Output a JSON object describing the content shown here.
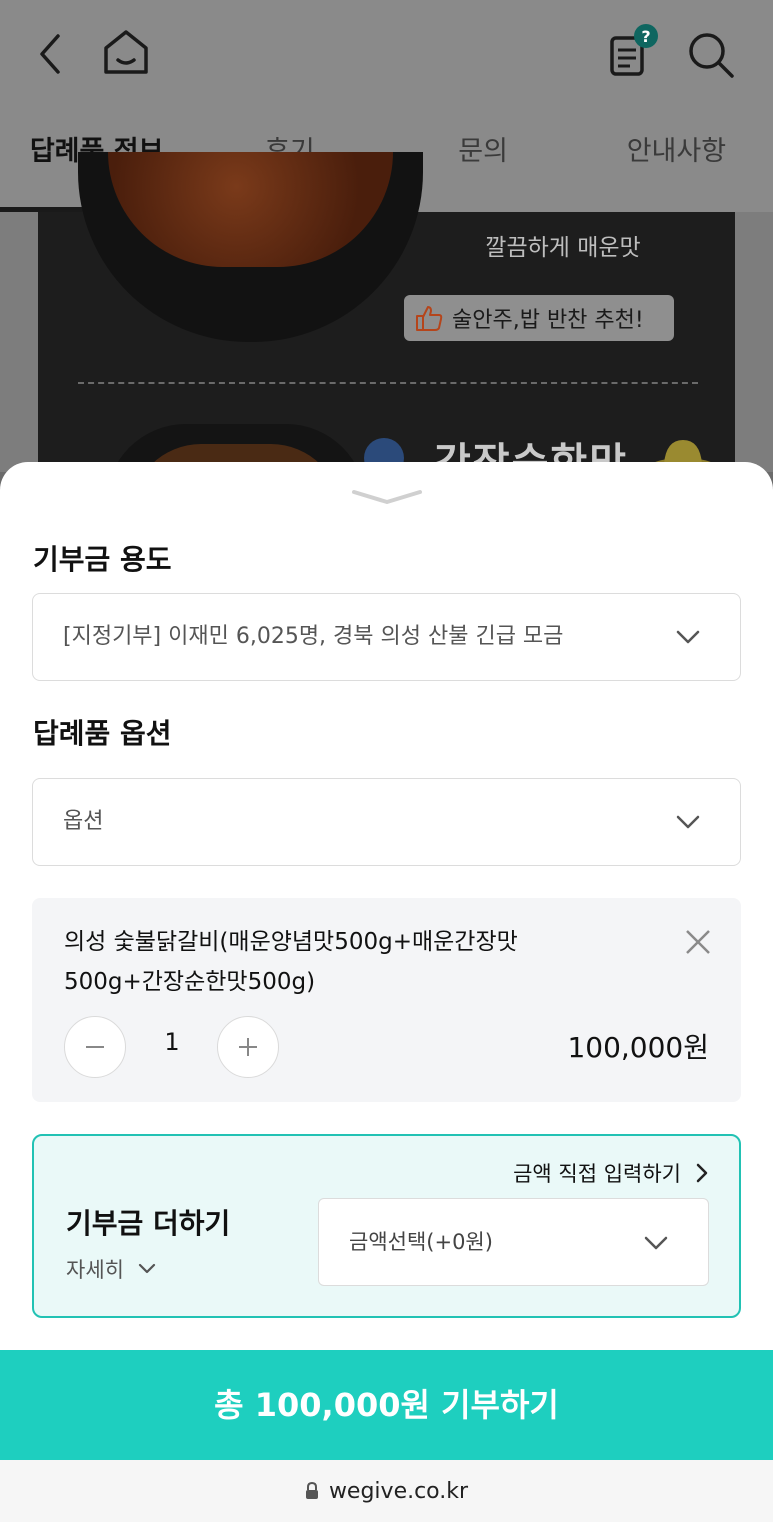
{
  "header": {
    "icons": {
      "back": "back-arrow-icon",
      "home": "home-icon",
      "notice": "document-question-icon",
      "search": "search-icon"
    },
    "badge": "?",
    "tabs": [
      {
        "label": "답례품 정보",
        "active": true
      },
      {
        "label": "후기",
        "active": false
      },
      {
        "label": "문의",
        "active": false
      },
      {
        "label": "안내사항",
        "active": false
      }
    ]
  },
  "promo": {
    "line1": "깔끔하게 매운맛",
    "badge": "술안주,밥 반찬 추천!",
    "partial_title": "간장순한맛"
  },
  "sheet": {
    "donation_purpose": {
      "title": "기부금 용도",
      "selected": "[지정기부] 이재민 6,025명, 경북 의성 산불 긴급 모금"
    },
    "gift_option": {
      "title": "답례품 옵션",
      "placeholder": "옵션"
    },
    "item": {
      "name": "의성 숯불닭갈비(매운양념맛500g+매운간장맛500g+간장순한맛500g)",
      "quantity": "1",
      "price": "100,000원"
    },
    "add_donation": {
      "direct_link": "금액 직접 입력하기",
      "title": "기부금 더하기",
      "detail": "자세히",
      "amount_selected": "금액선택(+0원)"
    }
  },
  "cta": {
    "label": "총 100,000원 기부하기"
  },
  "browser": {
    "url": "wegive.co.kr"
  },
  "colors": {
    "accent": "#1ecfbf",
    "accent_border": "#22c2b4",
    "accent_bg": "#eaf9f8",
    "dim_overlay": "#8a8a8a"
  }
}
